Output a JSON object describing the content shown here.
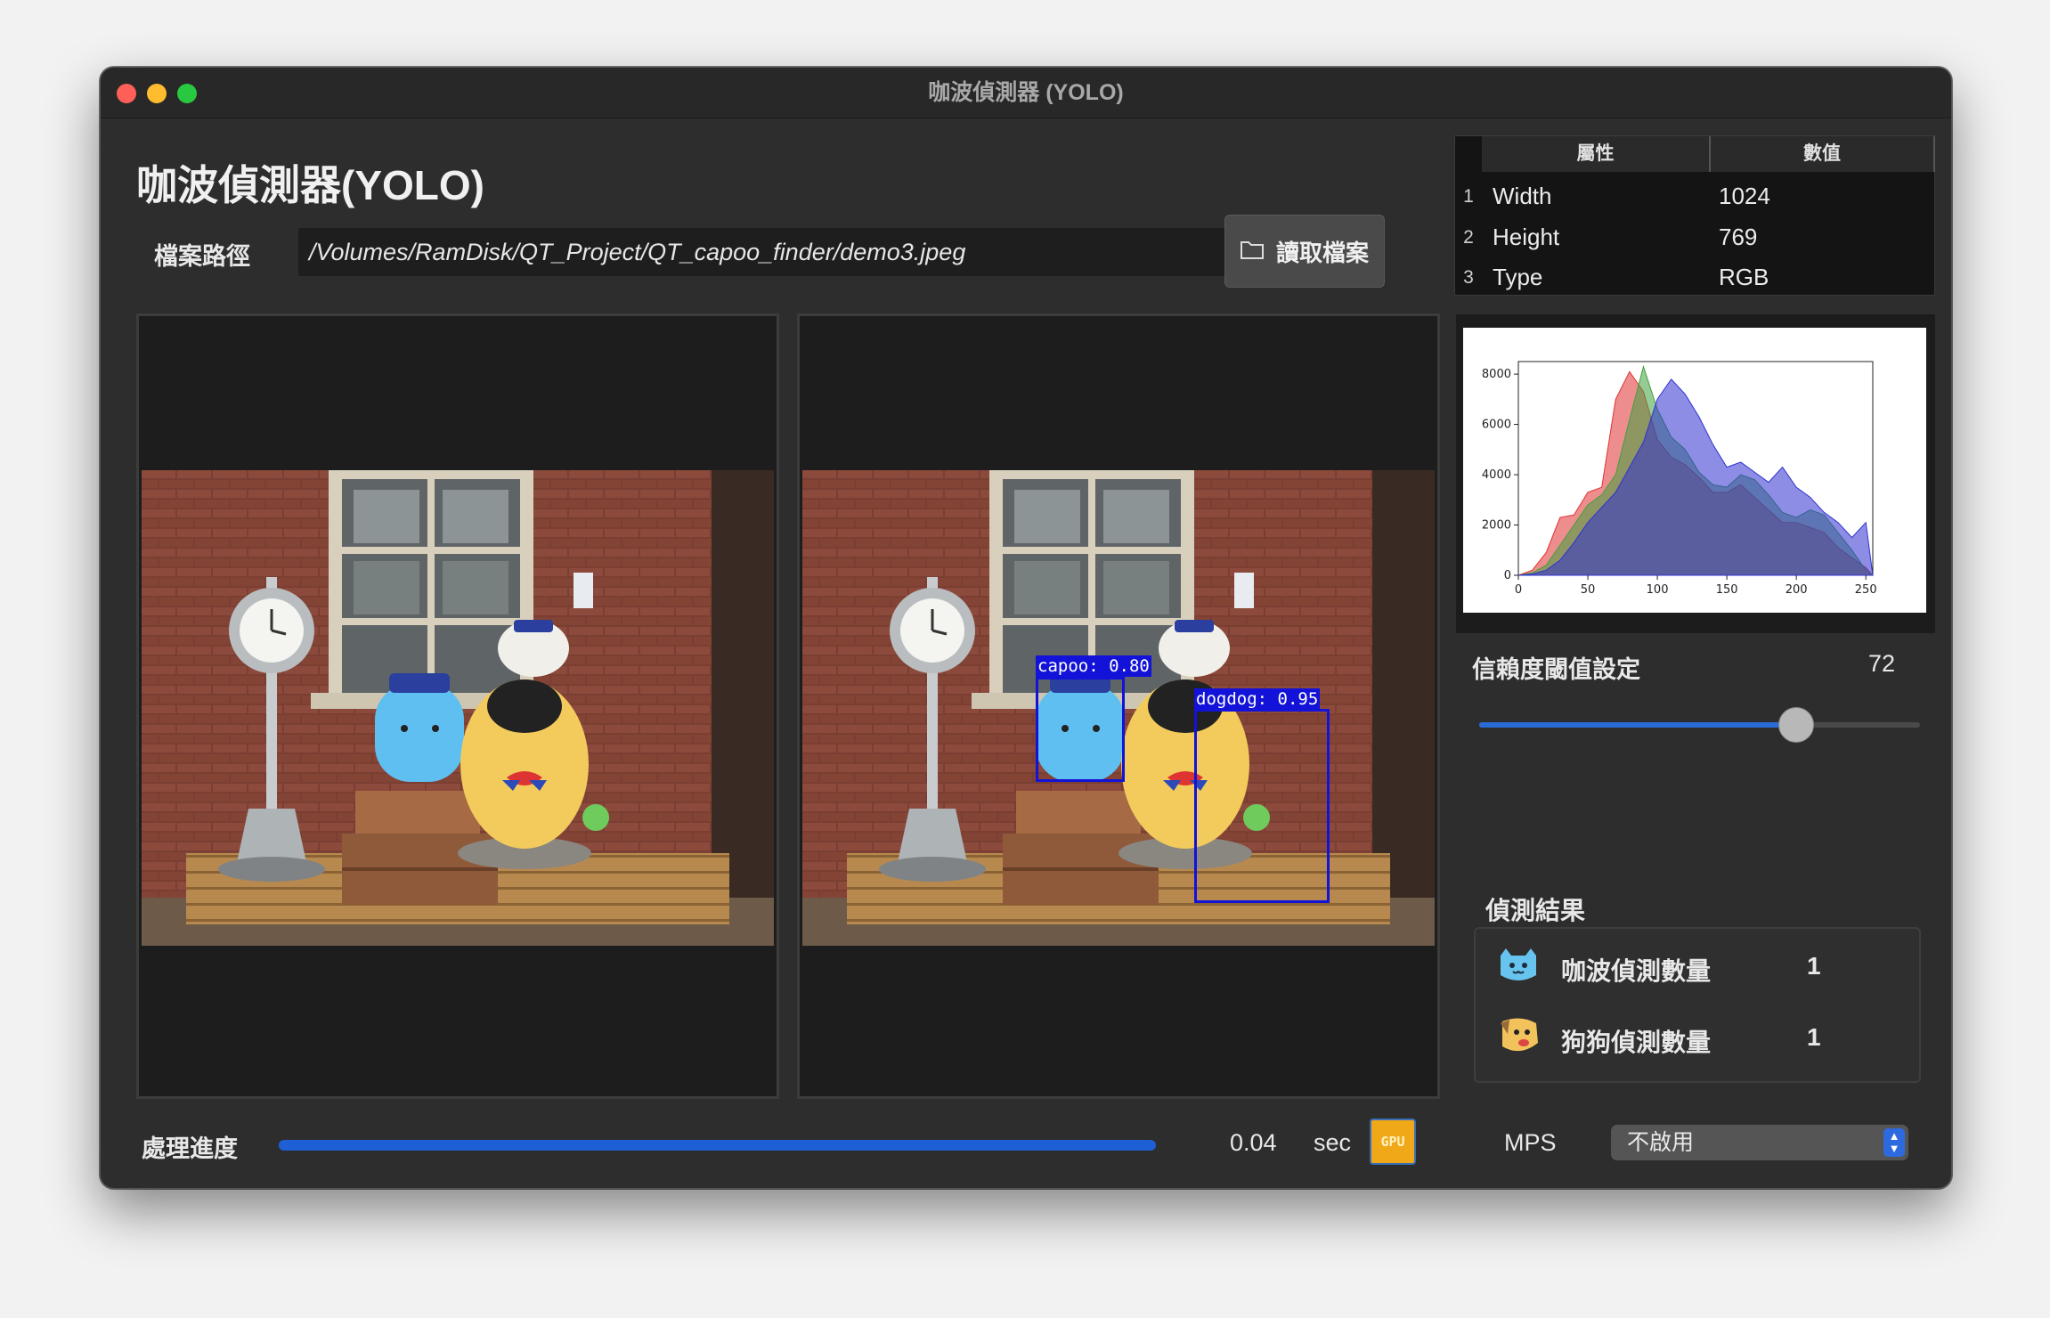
{
  "window": {
    "title": "咖波偵測器 (YOLO)"
  },
  "app": {
    "title": "咖波偵測器(YOLO)"
  },
  "file": {
    "path_label": "檔案路徑",
    "path_value": "/Volumes/RamDisk/QT_Project/QT_capoo_finder/demo3.jpeg",
    "open_button_label": "讀取檔案"
  },
  "detections": [
    {
      "label": "capoo: 0.80"
    },
    {
      "label": "dogdog: 0.95"
    }
  ],
  "properties": {
    "headers": [
      "屬性",
      "數值"
    ],
    "rows": [
      {
        "index": "1",
        "name": "Width",
        "value": "1024"
      },
      {
        "index": "2",
        "name": "Height",
        "value": "769"
      },
      {
        "index": "3",
        "name": "Type",
        "value": "RGB"
      }
    ]
  },
  "chart_data": {
    "type": "area",
    "title": "",
    "xlabel": "",
    "ylabel": "",
    "xlim": [
      0,
      255
    ],
    "ylim": [
      0,
      8500
    ],
    "xticks": [
      "0",
      "50",
      "100",
      "150",
      "200",
      "250"
    ],
    "yticks": [
      "0",
      "2000",
      "4000",
      "6000",
      "8000"
    ],
    "x": [
      0,
      10,
      20,
      30,
      40,
      50,
      60,
      70,
      80,
      90,
      100,
      110,
      120,
      130,
      140,
      150,
      160,
      170,
      180,
      190,
      200,
      210,
      220,
      230,
      240,
      250,
      255
    ],
    "series": [
      {
        "color": "#e03030",
        "values": [
          0,
          200,
          900,
          2300,
          2400,
          3300,
          3500,
          7000,
          8100,
          7300,
          5400,
          4700,
          4400,
          3900,
          3300,
          3300,
          3600,
          3100,
          2600,
          2100,
          2100,
          1900,
          1700,
          1100,
          700,
          300,
          0
        ]
      },
      {
        "color": "#40a040",
        "values": [
          0,
          100,
          400,
          1200,
          2000,
          2800,
          3200,
          4000,
          6200,
          8300,
          6600,
          5500,
          5000,
          4100,
          3600,
          3500,
          4000,
          3800,
          3200,
          2500,
          2300,
          2600,
          2400,
          1700,
          1000,
          200,
          0
        ]
      },
      {
        "color": "#3030d0",
        "values": [
          0,
          50,
          200,
          600,
          1300,
          2100,
          2700,
          3300,
          4300,
          5300,
          7000,
          7800,
          7200,
          6300,
          5200,
          4300,
          4500,
          4100,
          3700,
          4300,
          3500,
          3100,
          2500,
          2100,
          1500,
          2100,
          0
        ]
      }
    ]
  },
  "confidence": {
    "label": "信賴度閾值設定",
    "value": "72",
    "fraction": 0.72
  },
  "results": {
    "title": "偵測結果",
    "items": [
      {
        "label": "咖波偵測數量",
        "value": "1"
      },
      {
        "label": "狗狗偵測數量",
        "value": "1"
      }
    ]
  },
  "progress": {
    "label": "處理進度",
    "fraction": 1.0,
    "time": "0.04",
    "unit": "sec",
    "gpu_text": "GPU"
  },
  "mps": {
    "label": "MPS",
    "selected": "不啟用"
  }
}
